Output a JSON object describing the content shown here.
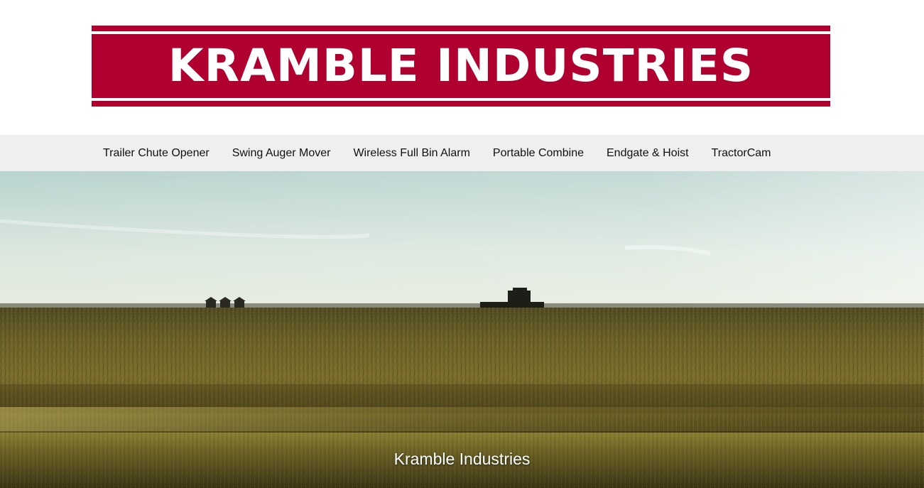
{
  "logo": {
    "text": "KRAMBLE INDUSTRIES",
    "brand_color": "#b0002f"
  },
  "nav": {
    "items": [
      {
        "label": "Trailer Chute Opener"
      },
      {
        "label": "Swing Auger Mover"
      },
      {
        "label": "Wireless Full Bin Alarm"
      },
      {
        "label": "Portable Combine"
      },
      {
        "label": "Endgate & Hoist"
      },
      {
        "label": "TractorCam"
      }
    ],
    "background": "#efefef"
  },
  "hero": {
    "caption": "Kramble Industries"
  }
}
